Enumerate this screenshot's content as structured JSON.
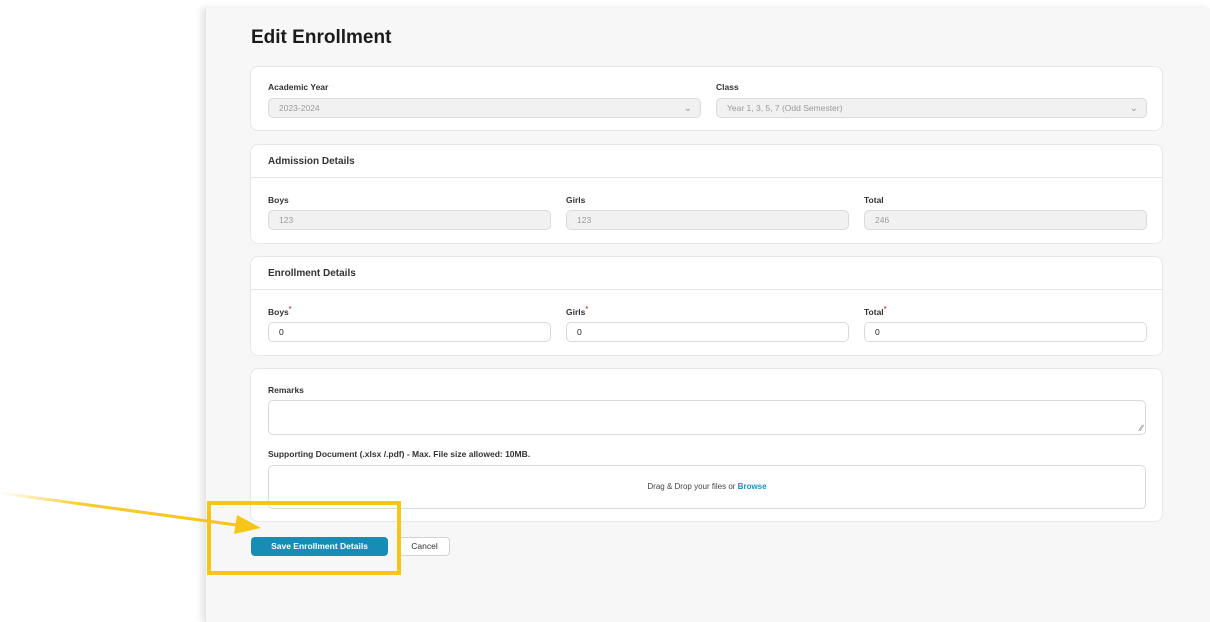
{
  "page": {
    "title": "Edit Enrollment"
  },
  "selection": {
    "academic_year": {
      "label": "Academic Year",
      "value": "2023-2024"
    },
    "class": {
      "label": "Class",
      "value": "Year 1, 3, 5, 7 (Odd Semester)"
    }
  },
  "admission": {
    "heading": "Admission Details",
    "boys": {
      "label": "Boys",
      "value": "123"
    },
    "girls": {
      "label": "Girls",
      "value": "123"
    },
    "total": {
      "label": "Total",
      "value": "246"
    }
  },
  "enrollment": {
    "heading": "Enrollment Details",
    "required_mark": "*",
    "boys": {
      "label": "Boys",
      "value": "0"
    },
    "girls": {
      "label": "Girls",
      "value": "0"
    },
    "total": {
      "label": "Total",
      "value": "0"
    }
  },
  "remarks": {
    "label": "Remarks",
    "document_label": "Supporting Document (.xlsx /.pdf) - Max. File size allowed: 10MB.",
    "dropzone_text": "Drag & Drop your files or ",
    "browse_text": "Browse"
  },
  "actions": {
    "save_label": "Save Enrollment Details",
    "cancel_label": "Cancel"
  },
  "colors": {
    "accent": "#178db5",
    "highlight": "#f5c518",
    "required": "#e23b3b"
  },
  "icons": {
    "dropdown": "chevron-down-icon",
    "annotation": "arrow-icon"
  }
}
